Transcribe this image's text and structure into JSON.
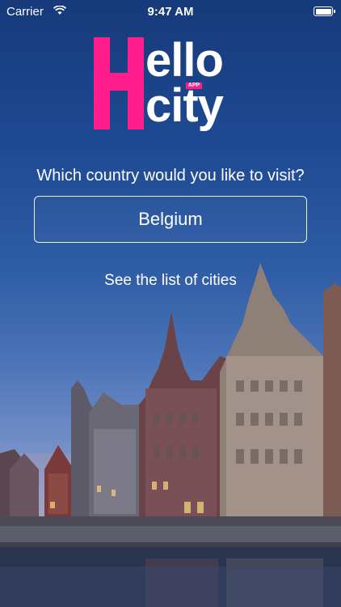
{
  "status_bar": {
    "carrier": "Carrier",
    "time": "9:47 AM",
    "battery_level": 1.0
  },
  "logo": {
    "letter": "H",
    "line1": "ello",
    "line2": "city",
    "badge": "APP",
    "accent_color": "#ff1e8c"
  },
  "main": {
    "question": "Which country would you like to visit?",
    "selected_country": "Belgium",
    "cities_link": "See the list of cities"
  }
}
